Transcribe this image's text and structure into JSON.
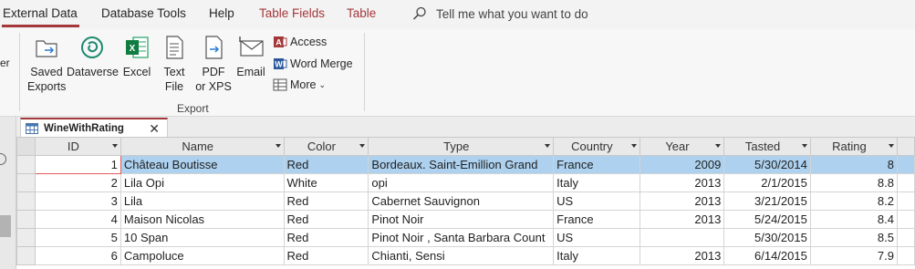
{
  "ribbon_tabs": [
    {
      "label": "External Data",
      "active": true
    },
    {
      "label": "Database Tools"
    },
    {
      "label": "Help"
    },
    {
      "label": "Table Fields",
      "contextual": true
    },
    {
      "label": "Table",
      "contextual": true
    }
  ],
  "tell_me": {
    "placeholder": "Tell me what you want to do",
    "icon": "search-icon"
  },
  "ribbon": {
    "left_cut_text": "er",
    "buttons": [
      {
        "label": "Saved\nExports",
        "icon": "saved-exports-icon"
      },
      {
        "label": "Dataverse",
        "icon": "dataverse-icon"
      },
      {
        "label": "Excel",
        "icon": "excel-icon"
      },
      {
        "label": "Text\nFile",
        "icon": "text-file-icon"
      },
      {
        "label": "PDF\nor XPS",
        "icon": "pdf-icon"
      },
      {
        "label": "Email",
        "icon": "email-icon"
      }
    ],
    "small_buttons": [
      {
        "label": "Access",
        "icon": "access-icon"
      },
      {
        "label": "Word Merge",
        "icon": "word-merge-icon"
      },
      {
        "label": "More",
        "icon": "more-icon"
      }
    ],
    "group_label": "Export"
  },
  "document_tab": {
    "title": "WineWithRating",
    "close": "✕"
  },
  "table": {
    "columns": [
      "ID",
      "Name",
      "Color",
      "Type",
      "Country",
      "Year",
      "Tasted",
      "Rating"
    ],
    "rows": [
      [
        "1",
        "Château Boutisse",
        "Red",
        "Bordeaux. Saint-Emillion Grand",
        "France",
        "2009",
        "5/30/2014",
        "8"
      ],
      [
        "2",
        "Lila Opi",
        "White",
        "opi",
        "Italy",
        "2013",
        "2/1/2015",
        "8.8"
      ],
      [
        "3",
        "Lila",
        "Red",
        "Cabernet Sauvignon",
        "US",
        "2013",
        "3/21/2015",
        "8.2"
      ],
      [
        "4",
        "Maison Nicolas",
        "Red",
        "Pinot Noir",
        "France",
        "2013",
        "5/24/2015",
        "8.4"
      ],
      [
        "5",
        "10 Span",
        "Red",
        "Pinot Noir , Santa Barbara Count",
        "US",
        "",
        "5/30/2015",
        "8.5"
      ],
      [
        "6",
        "Campoluce",
        "Red",
        "Chianti, Sensi",
        "Italy",
        "2013",
        "6/14/2015",
        "7.9"
      ]
    ]
  },
  "colors": {
    "accent": "#a4373a",
    "selected_row": "#add1ef"
  }
}
